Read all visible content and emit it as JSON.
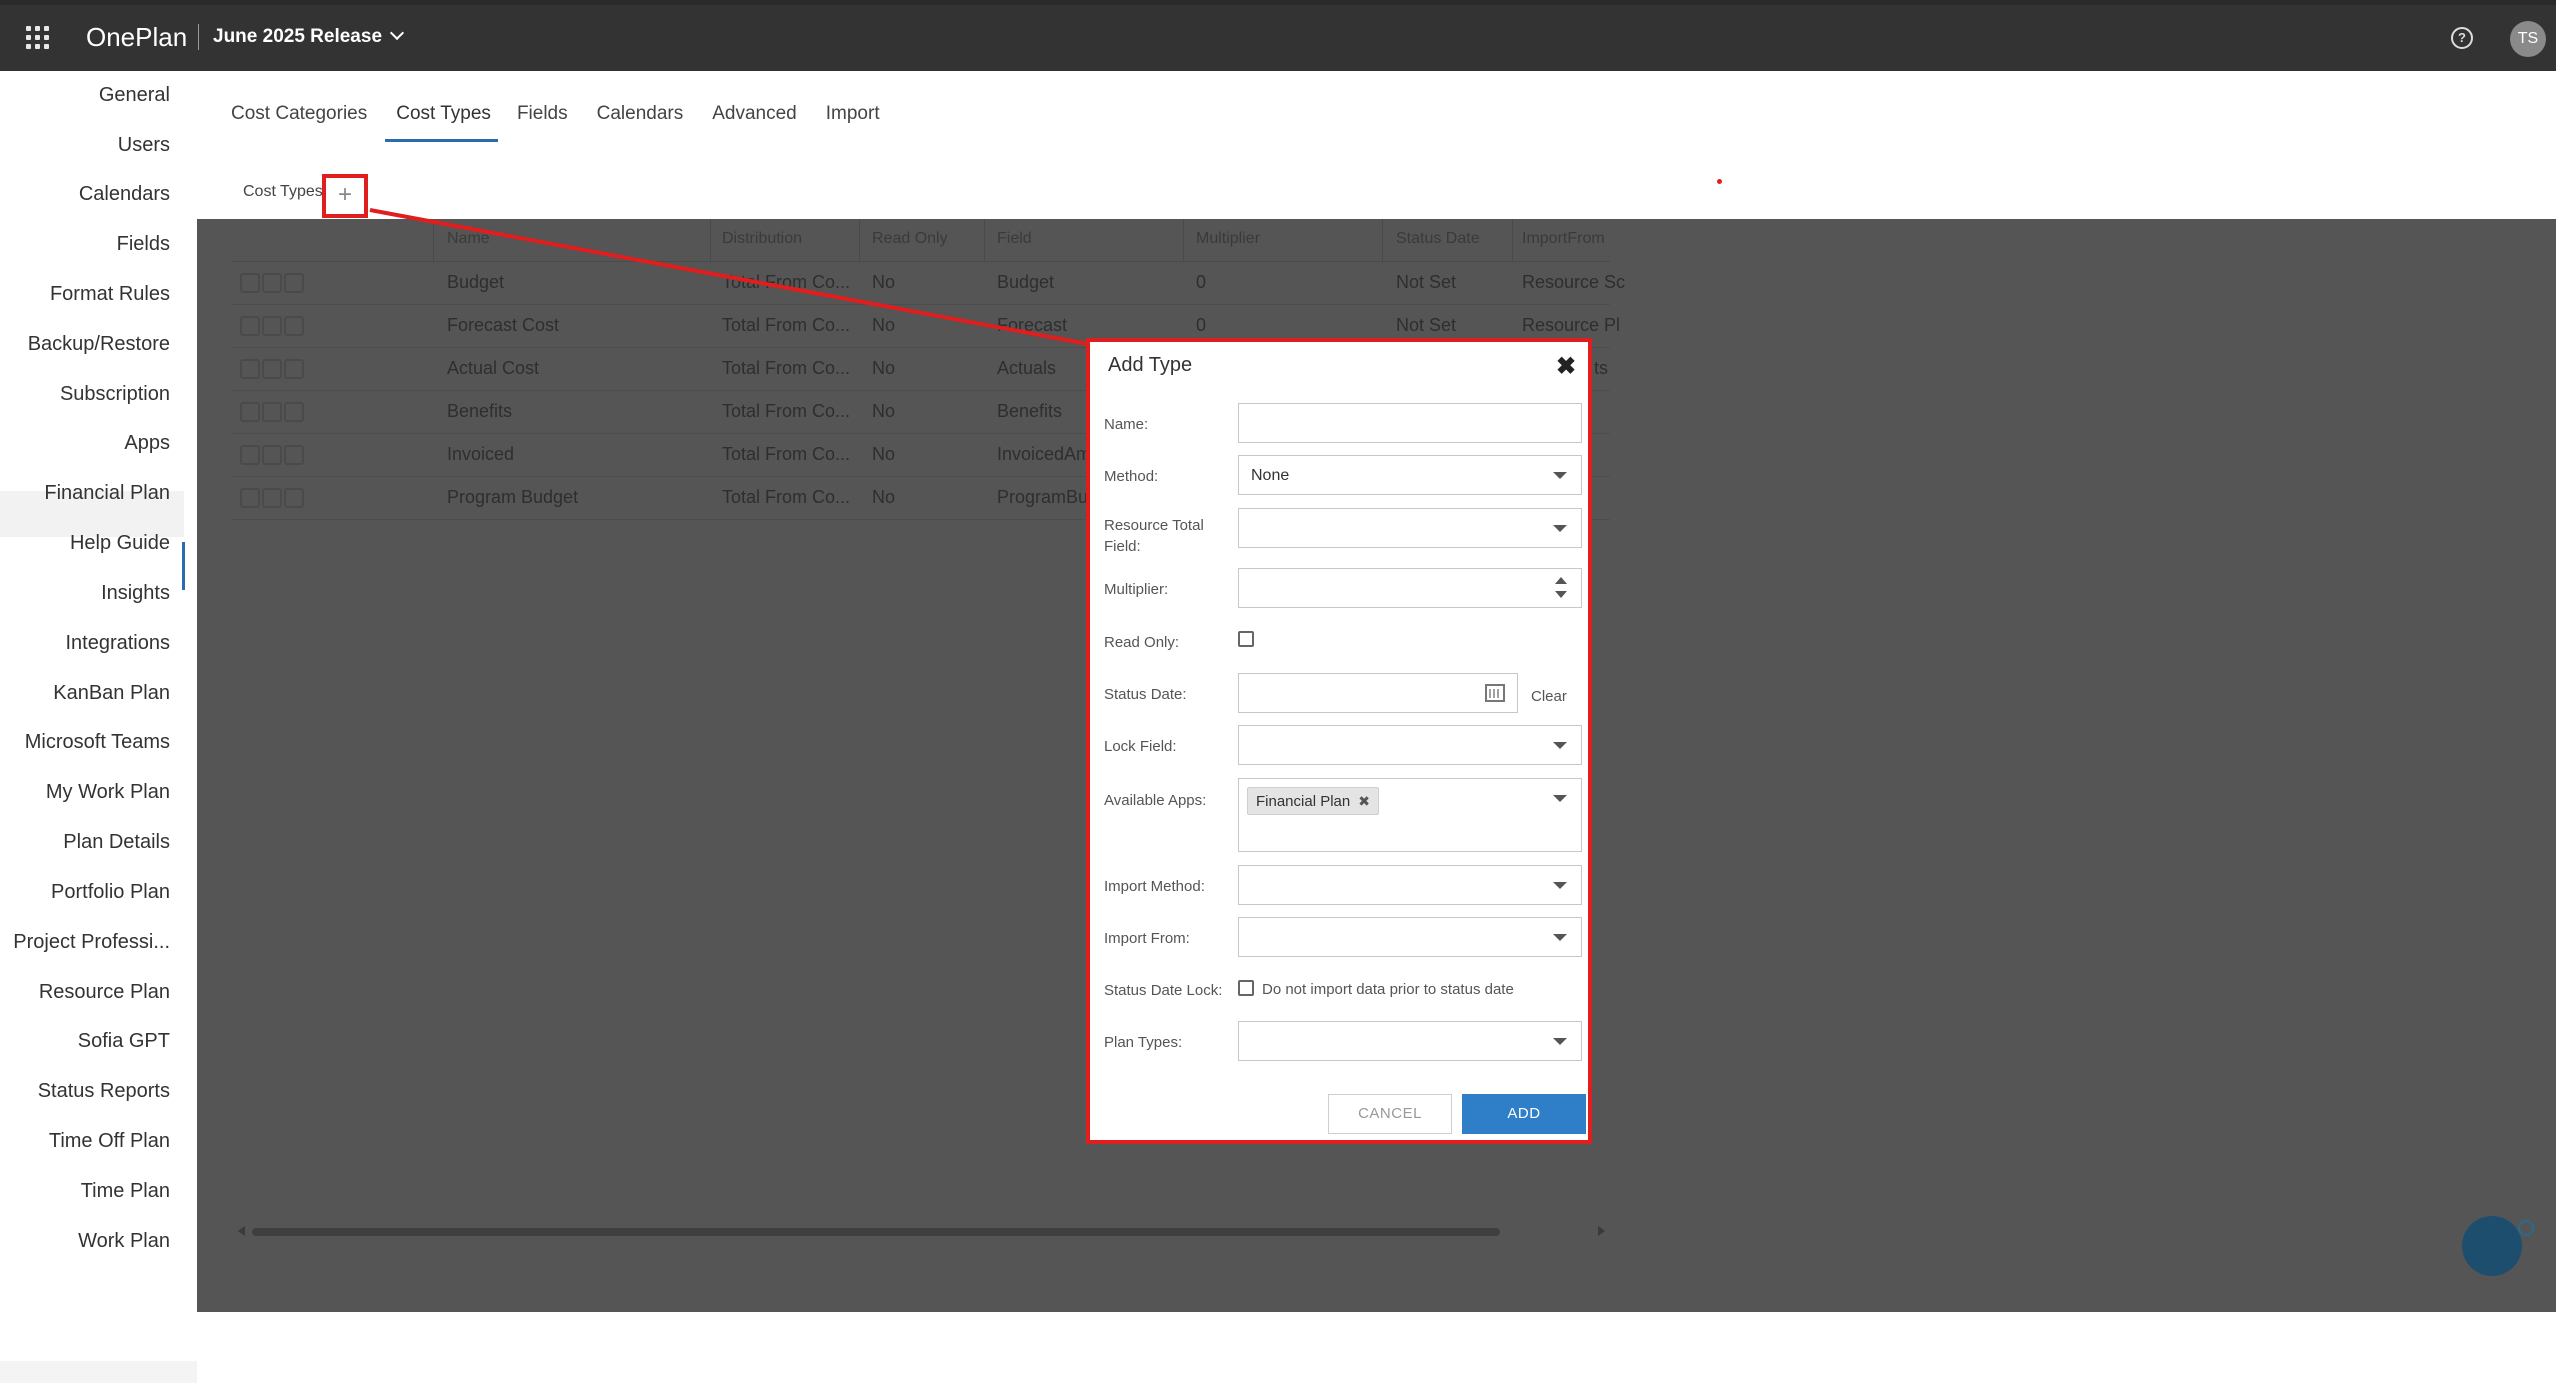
{
  "header": {
    "brand": "OnePlan",
    "release": "June 2025 Release",
    "help": "?",
    "avatar_initials": "TS"
  },
  "sidebar": {
    "items": [
      "General",
      "Users",
      "Calendars",
      "Fields",
      "Format Rules",
      "Backup/Restore",
      "Subscription",
      "Apps",
      "Financial Plan",
      "Help Guide",
      "Insights",
      "Integrations",
      "KanBan Plan",
      "Microsoft Teams",
      "My Work Plan",
      "Plan Details",
      "Portfolio Plan",
      "Project Professi...",
      "Resource Plan",
      "Sofia GPT",
      "Status Reports",
      "Time Off Plan",
      "Time Plan",
      "Work Plan"
    ],
    "active": "Financial Plan"
  },
  "tabs": [
    "Cost Categories",
    "Cost Types",
    "Fields",
    "Calendars",
    "Advanced",
    "Import"
  ],
  "active_tab": "Cost Types",
  "section_label": "Cost Types",
  "add_symbol": "+",
  "grid": {
    "columns": [
      "Name",
      "Distribution",
      "Read Only",
      "Field",
      "Multiplier",
      "Status Date",
      "ImportFrom"
    ],
    "rows": [
      [
        "Budget",
        "Total From Co...",
        "No",
        "Budget",
        "0",
        "Not Set",
        "Resource Sc"
      ],
      [
        "Forecast Cost",
        "Total From Co...",
        "No",
        "Forecast",
        "0",
        "Not Set",
        "Resource Pl"
      ],
      [
        "Actual Cost",
        "Total From Co...",
        "No",
        "Actuals",
        "",
        "",
        "ts"
      ],
      [
        "Benefits",
        "Total From Co...",
        "No",
        "Benefits",
        "",
        "",
        ""
      ],
      [
        "Invoiced",
        "Total From Co...",
        "No",
        "InvoicedAm",
        "",
        "",
        ""
      ],
      [
        "Program Budget",
        "Total From Co...",
        "No",
        "ProgramBu",
        "",
        "",
        ""
      ]
    ]
  },
  "dialog": {
    "title": "Add Type",
    "close": "✖",
    "labels": {
      "name": "Name:",
      "method": "Method:",
      "resource_total_field": "Resource Total Field:",
      "multiplier": "Multiplier:",
      "read_only": "Read Only:",
      "status_date": "Status Date:",
      "lock_field": "Lock Field:",
      "available_apps": "Available Apps:",
      "import_method": "Import Method:",
      "import_from": "Import From:",
      "status_date_lock": "Status Date Lock:",
      "plan_types": "Plan Types:"
    },
    "values": {
      "name": "",
      "method": "None",
      "resource_total_field": "",
      "multiplier": "",
      "status_date": "",
      "lock_field": "",
      "import_method": "",
      "import_from": "",
      "plan_types": ""
    },
    "available_apps_chip": "Financial Plan",
    "chip_remove": "✖",
    "clear": "Clear",
    "status_date_lock_text": "Do not import data prior to status date",
    "cancel": "CANCEL",
    "add": "ADD"
  },
  "colors": {
    "topbar": "#333333",
    "accent": "#2b6cb0",
    "highlight": "#e01e1e",
    "primary_button": "#2f7fc8"
  }
}
